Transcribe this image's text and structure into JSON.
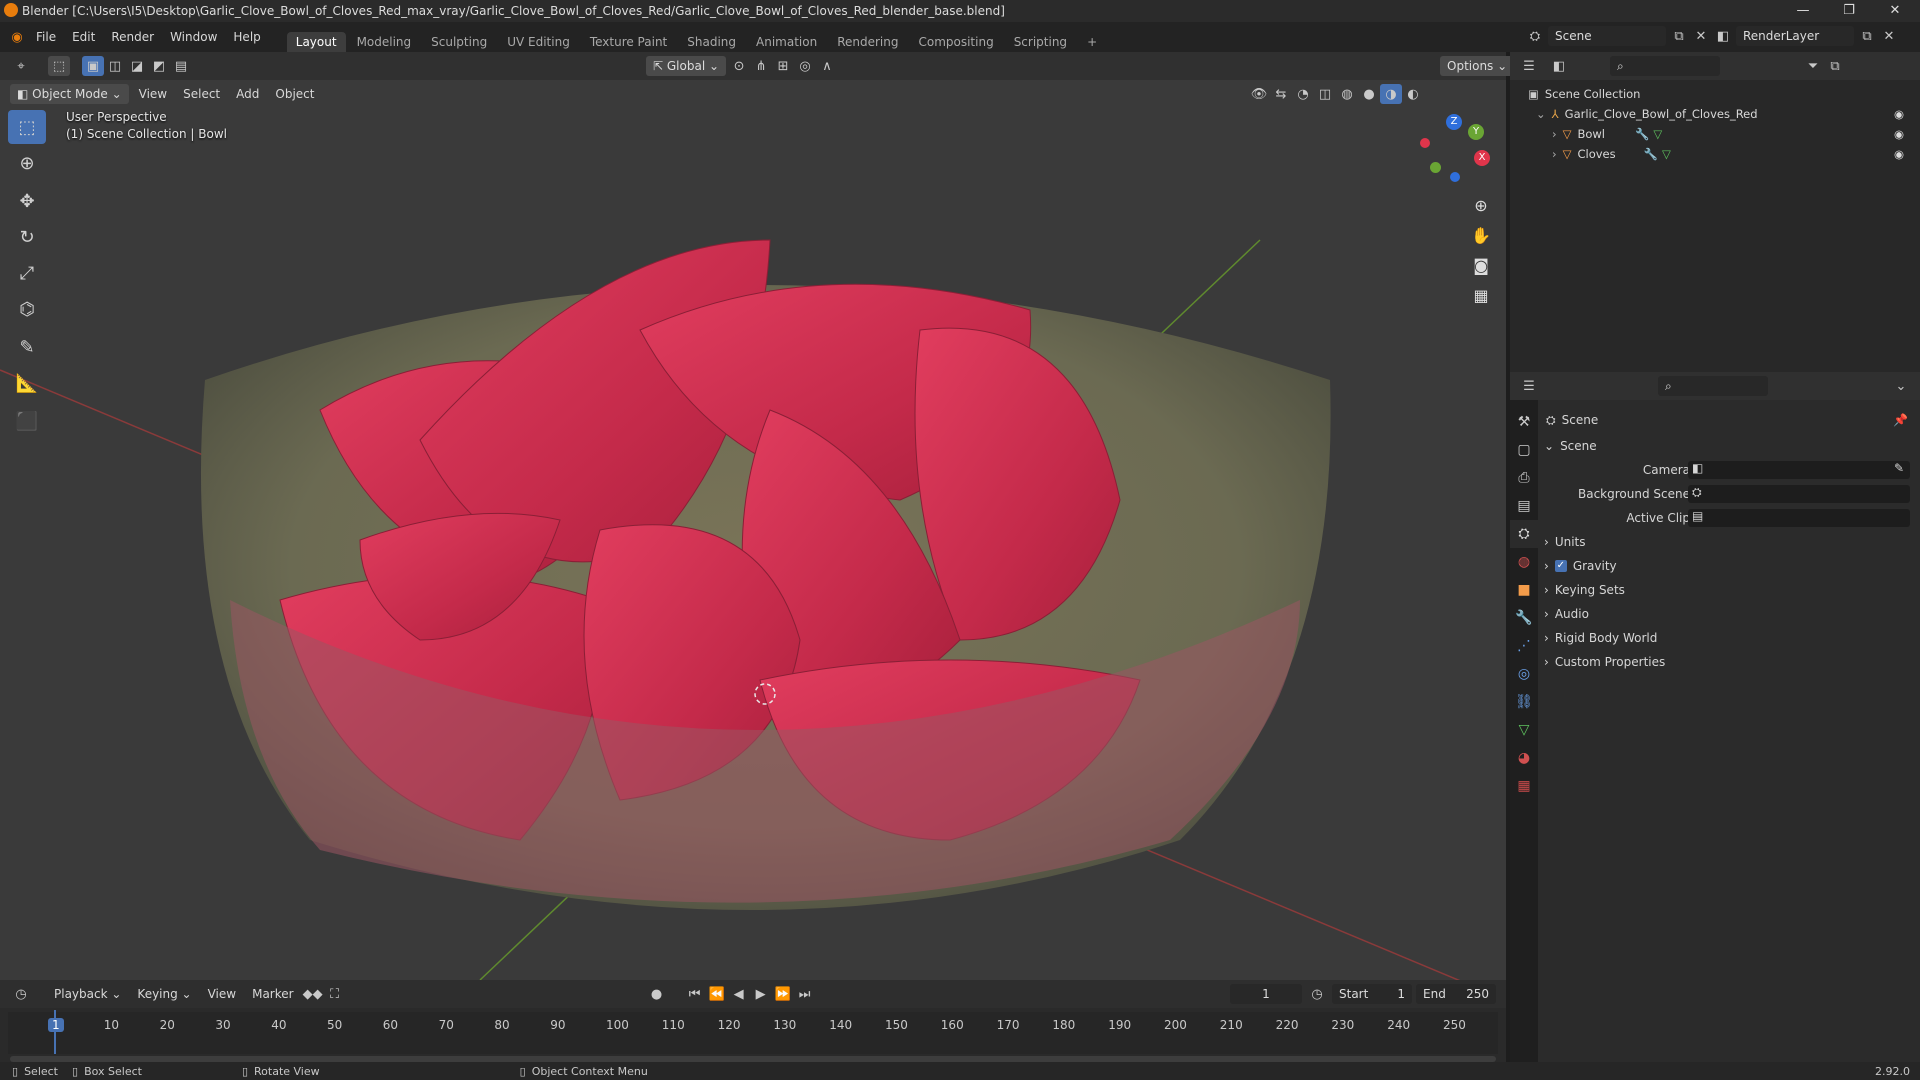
{
  "window": {
    "title": "Blender [C:\\Users\\I5\\Desktop\\Garlic_Clove_Bowl_of_Cloves_Red_max_vray/Garlic_Clove_Bowl_of_Cloves_Red/Garlic_Clove_Bowl_of_Cloves_Red_blender_base.blend]",
    "minimize": "—",
    "maximize": "❐",
    "close": "✕"
  },
  "menu": [
    "File",
    "Edit",
    "Render",
    "Window",
    "Help"
  ],
  "workspaces": [
    "Layout",
    "Modeling",
    "Sculpting",
    "UV Editing",
    "Texture Paint",
    "Shading",
    "Animation",
    "Rendering",
    "Compositing",
    "Scripting"
  ],
  "scene_selector": {
    "scene": "Scene",
    "render_layer": "RenderLayer"
  },
  "viewport_header": {
    "mode": "Object Mode",
    "menus": [
      "View",
      "Select",
      "Add",
      "Object"
    ],
    "orientation": "Global",
    "options": "Options"
  },
  "viewport": {
    "perspective": "User Perspective",
    "collection_info": "(1) Scene Collection | Bowl"
  },
  "gizmo": {
    "x": "X",
    "y": "Y",
    "z": "Z"
  },
  "outliner": {
    "root": "Scene Collection",
    "items": [
      {
        "label": "Garlic_Clove_Bowl_of_Cloves_Red"
      },
      {
        "label": "Bowl"
      },
      {
        "label": "Cloves"
      }
    ]
  },
  "properties": {
    "context": "Scene",
    "panel": "Scene",
    "fields": [
      {
        "label": "Camera"
      },
      {
        "label": "Background Scene"
      },
      {
        "label": "Active Clip"
      }
    ],
    "sections": [
      "Units",
      "Gravity",
      "Keying Sets",
      "Audio",
      "Rigid Body World",
      "Custom Properties"
    ],
    "gravity_checked": true
  },
  "timeline": {
    "menus": [
      "Playback",
      "Keying",
      "View",
      "Marker"
    ],
    "current_frame": "1",
    "start_label": "Start",
    "start": "1",
    "end_label": "End",
    "end": "250",
    "ticks": [
      "1",
      "10",
      "20",
      "30",
      "40",
      "50",
      "60",
      "70",
      "80",
      "90",
      "100",
      "110",
      "120",
      "130",
      "140",
      "150",
      "160",
      "170",
      "180",
      "190",
      "200",
      "210",
      "220",
      "230",
      "240",
      "250"
    ]
  },
  "statusbar": {
    "select": "Select",
    "box_select": "Box Select",
    "rotate_view": "Rotate View",
    "context_menu": "Object Context Menu",
    "version": "2.92.0"
  }
}
